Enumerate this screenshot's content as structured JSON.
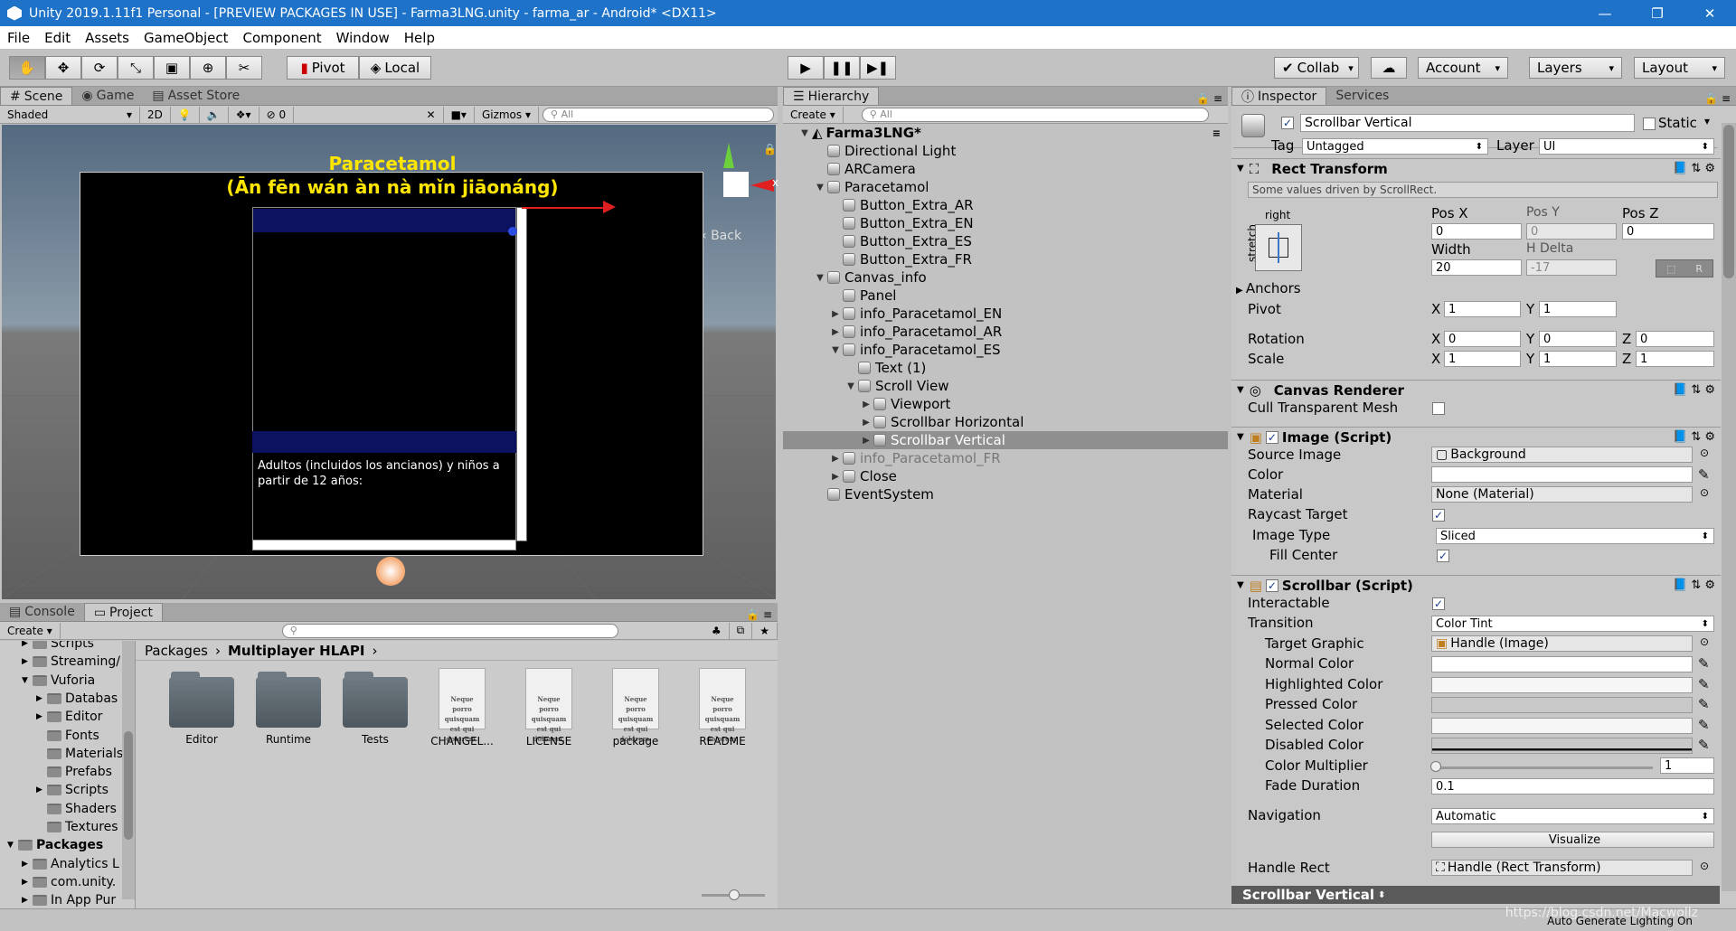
{
  "window": {
    "title": "Unity 2019.1.11f1 Personal - [PREVIEW PACKAGES IN USE] - Farma3LNG.unity - farma_ar - Android* <DX11>"
  },
  "menu": [
    "File",
    "Edit",
    "Assets",
    "GameObject",
    "Component",
    "Window",
    "Help"
  ],
  "toolbar": {
    "pivot": "Pivot",
    "local": "Local",
    "collab": "Collab",
    "account": "Account",
    "layers": "Layers",
    "layout": "Layout"
  },
  "scene_panel": {
    "tabs": [
      "Scene",
      "Game",
      "Asset Store"
    ],
    "shading": "Shaded",
    "mode2d": "2D",
    "gizmos": "Gizmos",
    "search_placeholder": "All",
    "hidden_count": "0",
    "canvas_title": "Paracetamol",
    "canvas_subtitle": "(Ān fēn wán àn nà mǐn jiāonáng)",
    "canvas_text": "Adultos (incluidos los ancianos) y niños a partir de 12 años:",
    "back_label": "Back",
    "axis_x": "x"
  },
  "hierarchy": {
    "tab": "Hierarchy",
    "create": "Create",
    "search_placeholder": "All",
    "scene": "Farma3LNG*",
    "items": [
      {
        "label": "Directional Light"
      },
      {
        "label": "ARCamera"
      },
      {
        "label": "Paracetamol"
      },
      {
        "label": "Button_Extra_AR"
      },
      {
        "label": "Button_Extra_EN"
      },
      {
        "label": "Button_Extra_ES"
      },
      {
        "label": "Button_Extra_FR"
      },
      {
        "label": "Canvas_info"
      },
      {
        "label": "Panel"
      },
      {
        "label": "info_Paracetamol_EN"
      },
      {
        "label": "info_Paracetamol_AR"
      },
      {
        "label": "info_Paracetamol_ES"
      },
      {
        "label": "Text (1)"
      },
      {
        "label": "Scroll View"
      },
      {
        "label": "Viewport"
      },
      {
        "label": "Scrollbar Horizontal"
      },
      {
        "label": "Scrollbar Vertical"
      },
      {
        "label": "info_Paracetamol_FR"
      },
      {
        "label": "Close"
      },
      {
        "label": "EventSystem"
      }
    ]
  },
  "inspector": {
    "tabs": [
      "Inspector",
      "Services"
    ],
    "object_name": "Scrollbar Vertical",
    "static_label": "Static",
    "tag_label": "Tag",
    "tag_value": "Untagged",
    "layer_label": "Layer",
    "layer_value": "UI",
    "rect": {
      "title": "Rect Transform",
      "note": "Some values driven by ScrollRect.",
      "anchor_h": "right",
      "anchor_v": "stretch",
      "posx_label": "Pos X",
      "posy_label": "Pos Y",
      "posz_label": "Pos Z",
      "posx": "0",
      "posy": "0",
      "posz": "0",
      "width_label": "Width",
      "hdelta_label": "H Delta",
      "width": "20",
      "hdelta": "-17",
      "anchors": "Anchors",
      "pivot": "Pivot",
      "pivot_x": "1",
      "pivot_y": "1",
      "rotation": "Rotation",
      "rot_x": "0",
      "rot_y": "0",
      "rot_z": "0",
      "scale": "Scale",
      "scale_x": "1",
      "scale_y": "1",
      "scale_z": "1",
      "raw_btn": "R",
      "x": "X",
      "y": "Y",
      "z": "Z"
    },
    "canvas_renderer": {
      "title": "Canvas Renderer",
      "cull": "Cull Transparent Mesh"
    },
    "image": {
      "title": "Image (Script)",
      "source_label": "Source Image",
      "source": "Background",
      "color_label": "Color",
      "material_label": "Material",
      "material": "None (Material)",
      "raycast": "Raycast Target",
      "type_label": "Image Type",
      "type": "Sliced",
      "fill": "Fill Center"
    },
    "scrollbar": {
      "title": "Scrollbar (Script)",
      "interactable": "Interactable",
      "transition_label": "Transition",
      "transition": "Color Tint",
      "target_label": "Target Graphic",
      "target": "Handle (Image)",
      "normal": "Normal Color",
      "highlighted": "Highlighted Color",
      "pressed": "Pressed Color",
      "selected": "Selected Color",
      "disabled": "Disabled Color",
      "multiplier_label": "Color Multiplier",
      "multiplier": "1",
      "fade_label": "Fade Duration",
      "fade": "0.1",
      "navigation_label": "Navigation",
      "navigation": "Automatic",
      "visualize": "Visualize",
      "handle_label": "Handle Rect",
      "handle": "Handle (Rect Transform)"
    },
    "footer": "Scrollbar Vertical"
  },
  "project": {
    "tabs": [
      "Console",
      "Project"
    ],
    "create": "Create",
    "breadcrumb_root": "Packages",
    "breadcrumb_leaf": "Multiplayer HLAPI",
    "tree": [
      "Scripts",
      "Streaming/",
      "Vuforia",
      "Databas",
      "Editor",
      "Fonts",
      "Materials",
      "Prefabs",
      "Scripts",
      "Shaders",
      "Textures",
      "Packages",
      "Analytics L",
      "com.unity.",
      "In App Pur"
    ],
    "items": [
      {
        "label": "Editor"
      },
      {
        "label": "Runtime"
      },
      {
        "label": "Tests"
      },
      {
        "label": "CHANGEL..."
      },
      {
        "label": "LICENSE"
      },
      {
        "label": "package"
      },
      {
        "label": "README"
      }
    ],
    "doc_text": "Neque porro quisquam est qui dolorem."
  },
  "status": {
    "auto_lighting": "Auto Generate Lighting On",
    "watermark": "https://blog.csdn.net/Macwollz"
  }
}
